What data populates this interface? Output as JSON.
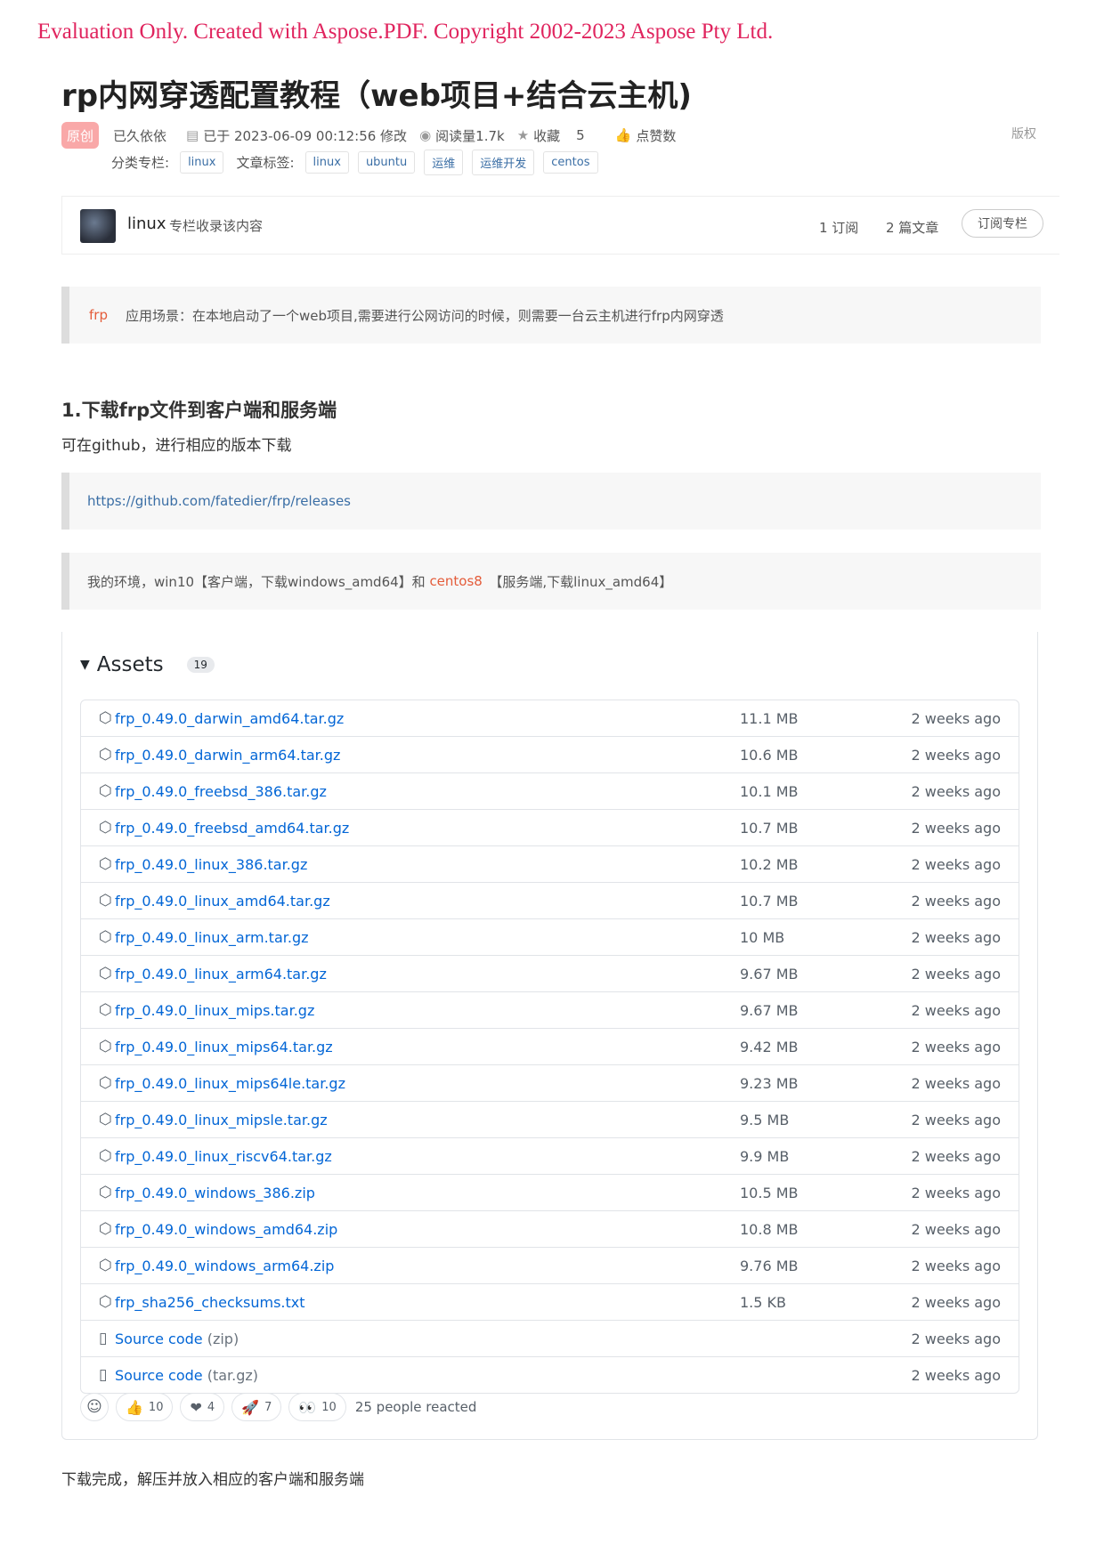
{
  "watermark": "Evaluation Only. Created with Aspose.PDF. Copyright 2002-2023 Aspose Pty Ltd.",
  "title": "rp内网穿透配置教程（web项目+结合云主机)",
  "meta": {
    "original_badge": "原创",
    "author": "已久依依",
    "updated": "已于 2023-06-09 00:12:56 修改",
    "reads": "阅读量1.7k",
    "favorites_label": "收藏",
    "favorites_count": "5",
    "likes_label": "点赞数",
    "copyright": "版权",
    "category_label": "分类专栏:",
    "category": "linux",
    "tags_label": "文章标签:",
    "tags": [
      "linux",
      "ubuntu",
      "运维",
      "运维开发",
      "centos"
    ]
  },
  "column": {
    "name": "linux",
    "desc": "专栏收录该内容",
    "subscriptions": "1 订阅",
    "articles": "2 篇文章",
    "subscribe_button": "订阅专栏"
  },
  "quote1": {
    "frp": "frp",
    "text": "应用场景：在本地启动了一个web项目,需要进行公网访问的时候，则需要一台云主机进行frp内网穿透"
  },
  "section1": {
    "heading": "1.下载frp文件到客户端和服务端",
    "para": "可在github，进行相应的版本下载"
  },
  "quote2": {
    "link": "https://github.com/fatedier/frp/releases"
  },
  "quote3": {
    "before": "我的环境，win10【客户端，下载windows_amd64】和 ",
    "highlight": "centos8",
    "after": "　【服务端,下载linux_amd64】"
  },
  "assets": {
    "title": "Assets",
    "count": "19",
    "files": [
      {
        "name": "frp_0.49.0_darwin_amd64.tar.gz",
        "size": "11.1 MB",
        "date": "2 weeks ago"
      },
      {
        "name": "frp_0.49.0_darwin_arm64.tar.gz",
        "size": "10.6 MB",
        "date": "2 weeks ago"
      },
      {
        "name": "frp_0.49.0_freebsd_386.tar.gz",
        "size": "10.1 MB",
        "date": "2 weeks ago"
      },
      {
        "name": "frp_0.49.0_freebsd_amd64.tar.gz",
        "size": "10.7 MB",
        "date": "2 weeks ago"
      },
      {
        "name": "frp_0.49.0_linux_386.tar.gz",
        "size": "10.2 MB",
        "date": "2 weeks ago"
      },
      {
        "name": "frp_0.49.0_linux_amd64.tar.gz",
        "size": "10.7 MB",
        "date": "2 weeks ago"
      },
      {
        "name": "frp_0.49.0_linux_arm.tar.gz",
        "size": "10 MB",
        "date": "2 weeks ago"
      },
      {
        "name": "frp_0.49.0_linux_arm64.tar.gz",
        "size": "9.67 MB",
        "date": "2 weeks ago"
      },
      {
        "name": "frp_0.49.0_linux_mips.tar.gz",
        "size": "9.67 MB",
        "date": "2 weeks ago"
      },
      {
        "name": "frp_0.49.0_linux_mips64.tar.gz",
        "size": "9.42 MB",
        "date": "2 weeks ago"
      },
      {
        "name": "frp_0.49.0_linux_mips64le.tar.gz",
        "size": "9.23 MB",
        "date": "2 weeks ago"
      },
      {
        "name": "frp_0.49.0_linux_mipsle.tar.gz",
        "size": "9.5 MB",
        "date": "2 weeks ago"
      },
      {
        "name": "frp_0.49.0_linux_riscv64.tar.gz",
        "size": "9.9 MB",
        "date": "2 weeks ago"
      },
      {
        "name": "frp_0.49.0_windows_386.zip",
        "size": "10.5 MB",
        "date": "2 weeks ago"
      },
      {
        "name": "frp_0.49.0_windows_amd64.zip",
        "size": "10.8 MB",
        "date": "2 weeks ago"
      },
      {
        "name": "frp_0.49.0_windows_arm64.zip",
        "size": "9.76 MB",
        "date": "2 weeks ago"
      },
      {
        "name": "frp_sha256_checksums.txt",
        "size": "1.5 KB",
        "date": "2 weeks ago"
      }
    ],
    "source": [
      {
        "name": "Source code",
        "ext": "(zip)",
        "date": "2 weeks ago"
      },
      {
        "name": "Source code",
        "ext": "(tar.gz)",
        "date": "2 weeks ago"
      }
    ],
    "reactions": [
      {
        "emoji": "👍",
        "icon": "thumbs-up-icon",
        "count": "10"
      },
      {
        "emoji": "❤",
        "icon": "heart-icon",
        "count": "4"
      },
      {
        "emoji": "🚀",
        "icon": "rocket-icon",
        "count": "7"
      },
      {
        "emoji": "👀",
        "icon": "eyes-icon",
        "count": "10"
      }
    ],
    "reacted_text": "25 people reacted"
  },
  "closing": "下载完成，解压并放入相应的客户端和服务端"
}
